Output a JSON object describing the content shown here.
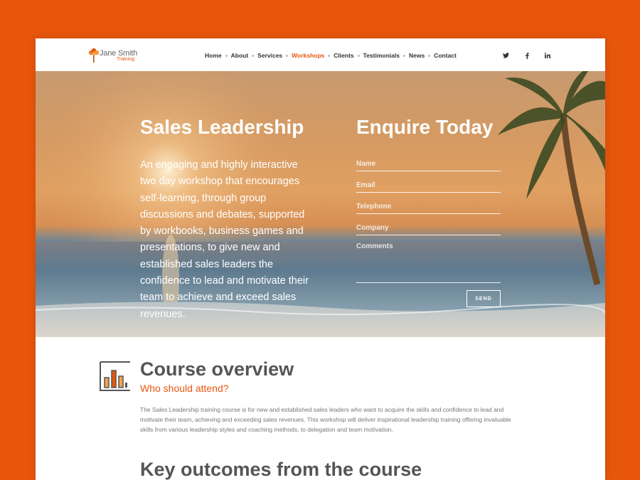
{
  "brand": {
    "name": "Jane Smith",
    "sub": "Training",
    "accent": "#e8560c"
  },
  "nav": {
    "items": [
      {
        "label": "Home"
      },
      {
        "label": "About"
      },
      {
        "label": "Services"
      },
      {
        "label": "Workshops",
        "active": true
      },
      {
        "label": "Clients"
      },
      {
        "label": "Testimonials"
      },
      {
        "label": "News"
      },
      {
        "label": "Contact"
      }
    ],
    "social": [
      "twitter-icon",
      "facebook-icon",
      "linkedin-icon"
    ]
  },
  "hero": {
    "title": "Sales Leadership",
    "text": "An engaging and highly interactive two day workshop that encourages self-learning, through group discussions and debates, supported by workbooks, business games and presentations, to give new and established sales leaders the confidence to lead and motivate their team to achieve and exceed sales revenues."
  },
  "enquiry": {
    "title": "Enquire Today",
    "name_placeholder": "Name",
    "email_placeholder": "Email",
    "telephone_placeholder": "Telephone",
    "company_placeholder": "Company",
    "comments_placeholder": "Comments",
    "send_label": "SEND"
  },
  "overview": {
    "title": "Course overview",
    "subtitle": "Who should attend?",
    "body": "The Sales Leadership training course is for new and established sales leaders who want to acquire the skills and confidence to lead and motivate their team, achieving and exceeding sales revenues. This workshop will deliver inspirational leadership training offering invaluable skills from various leadership styles and coaching methods, to delegation and team motivation.",
    "icon": "bar-chart-icon"
  },
  "outcomes": {
    "title": "Key outcomes from the course"
  }
}
